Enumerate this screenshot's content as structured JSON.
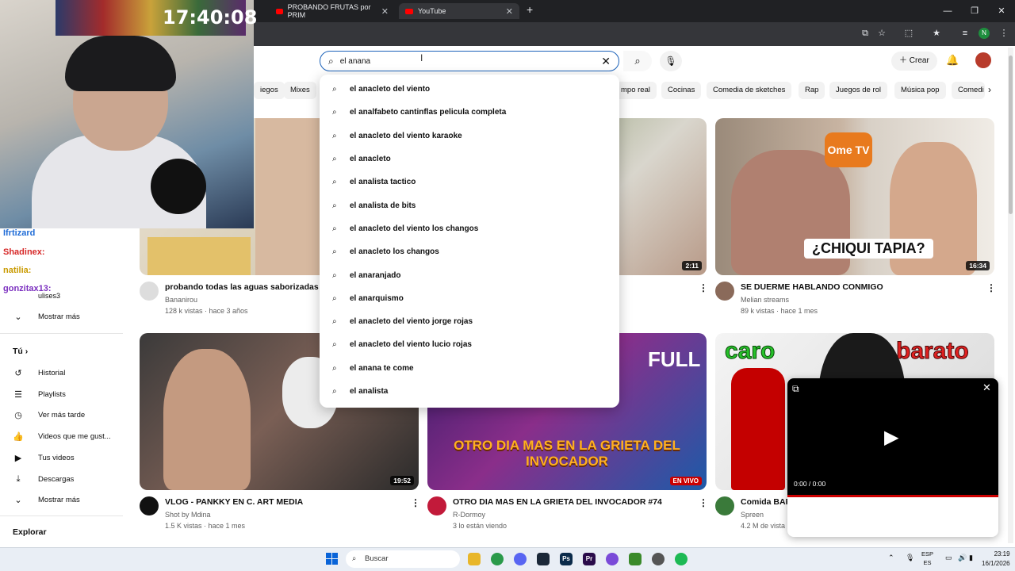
{
  "browser": {
    "tabs": [
      {
        "title": "PROBANDO FRUTAS por PRIM"
      },
      {
        "title": "YouTube"
      }
    ],
    "profile_initial": "N"
  },
  "stream": {
    "clock": "17:40:08"
  },
  "chat": [
    {
      "user": "Ifrtizard",
      "color": "#1e6bd6"
    },
    {
      "user": "Shadinex:",
      "color": "#d62828"
    },
    {
      "user": "natilia:",
      "color": "#c99a00"
    },
    {
      "user": "gonzitax13:",
      "color": "#7b2fbf"
    }
  ],
  "header": {
    "search_value": "el anana",
    "create_label": "Crear"
  },
  "chips": [
    "iegos",
    "Mixes",
    "mpo real",
    "Cocinas",
    "Comedia de sketches",
    "Rap",
    "Juegos de rol",
    "Música pop",
    "Comedi"
  ],
  "suggestions": [
    "el anacleto del viento",
    "el analfabeto cantinflas pelicula completa",
    "el anacleto del viento karaoke",
    "el anacleto",
    "el analista tactico",
    "el analista de bits",
    "el anacleto del viento los changos",
    "el anacleto los changos",
    "el anaranjado",
    "el anarquismo",
    "el anacleto del viento jorge rojas",
    "el anacleto del viento lucio rojas",
    "el anana te come",
    "el analista"
  ],
  "sidebar": {
    "sub_partial": "ulises3",
    "show_more_1": "Mostrar más",
    "you_label": "Tú",
    "items": [
      "Historial",
      "Playlists",
      "Ver más tarde",
      "Videos que me gust...",
      "Tus videos",
      "Descargas"
    ],
    "show_more_2": "Mostrar más",
    "explore_label": "Explorar"
  },
  "videos": [
    {
      "title": "probando todas las aguas saborizadas !!",
      "channel": "Bananirou",
      "meta": "128 k vistas · hace 3 años"
    },
    {
      "title": "",
      "channel": "",
      "meta": "",
      "duration": "2:11"
    },
    {
      "title": "SE DUERME HABLANDO CONMIGO",
      "channel": "Melian streams",
      "meta": "89 k vistas · hace 1 mes",
      "duration": "16:34",
      "overlay": "¿CHIQUI TAPIA?",
      "badge": "Ome TV"
    },
    {
      "title": "VLOG - PANKKY EN C. ART MEDIA",
      "channel": "Shot by Mdina",
      "meta": "1.5 K vistas · hace 1 mes",
      "duration": "19:52"
    },
    {
      "title": "OTRO DIA MAS EN LA GRIETA DEL INVOCADOR #74",
      "channel": "R-Dormoy",
      "meta": "3 lo están viendo",
      "live_label": "EN VIVO",
      "overlay": "OTRO DIA MAS EN LA GRIETA DEL INVOCADOR",
      "corner": "FULL"
    },
    {
      "title": "Comida BAR",
      "channel": "Spreen",
      "meta": "4.2 M de vista",
      "overlay_left": "caro",
      "overlay_right": "barato"
    }
  ],
  "miniplayer": {
    "time": "0:00 / 0:00"
  },
  "taskbar": {
    "search_label": "Buscar",
    "lang_1": "ESP",
    "lang_2": "ES",
    "time": "23:19",
    "date": "16/1/2026"
  }
}
